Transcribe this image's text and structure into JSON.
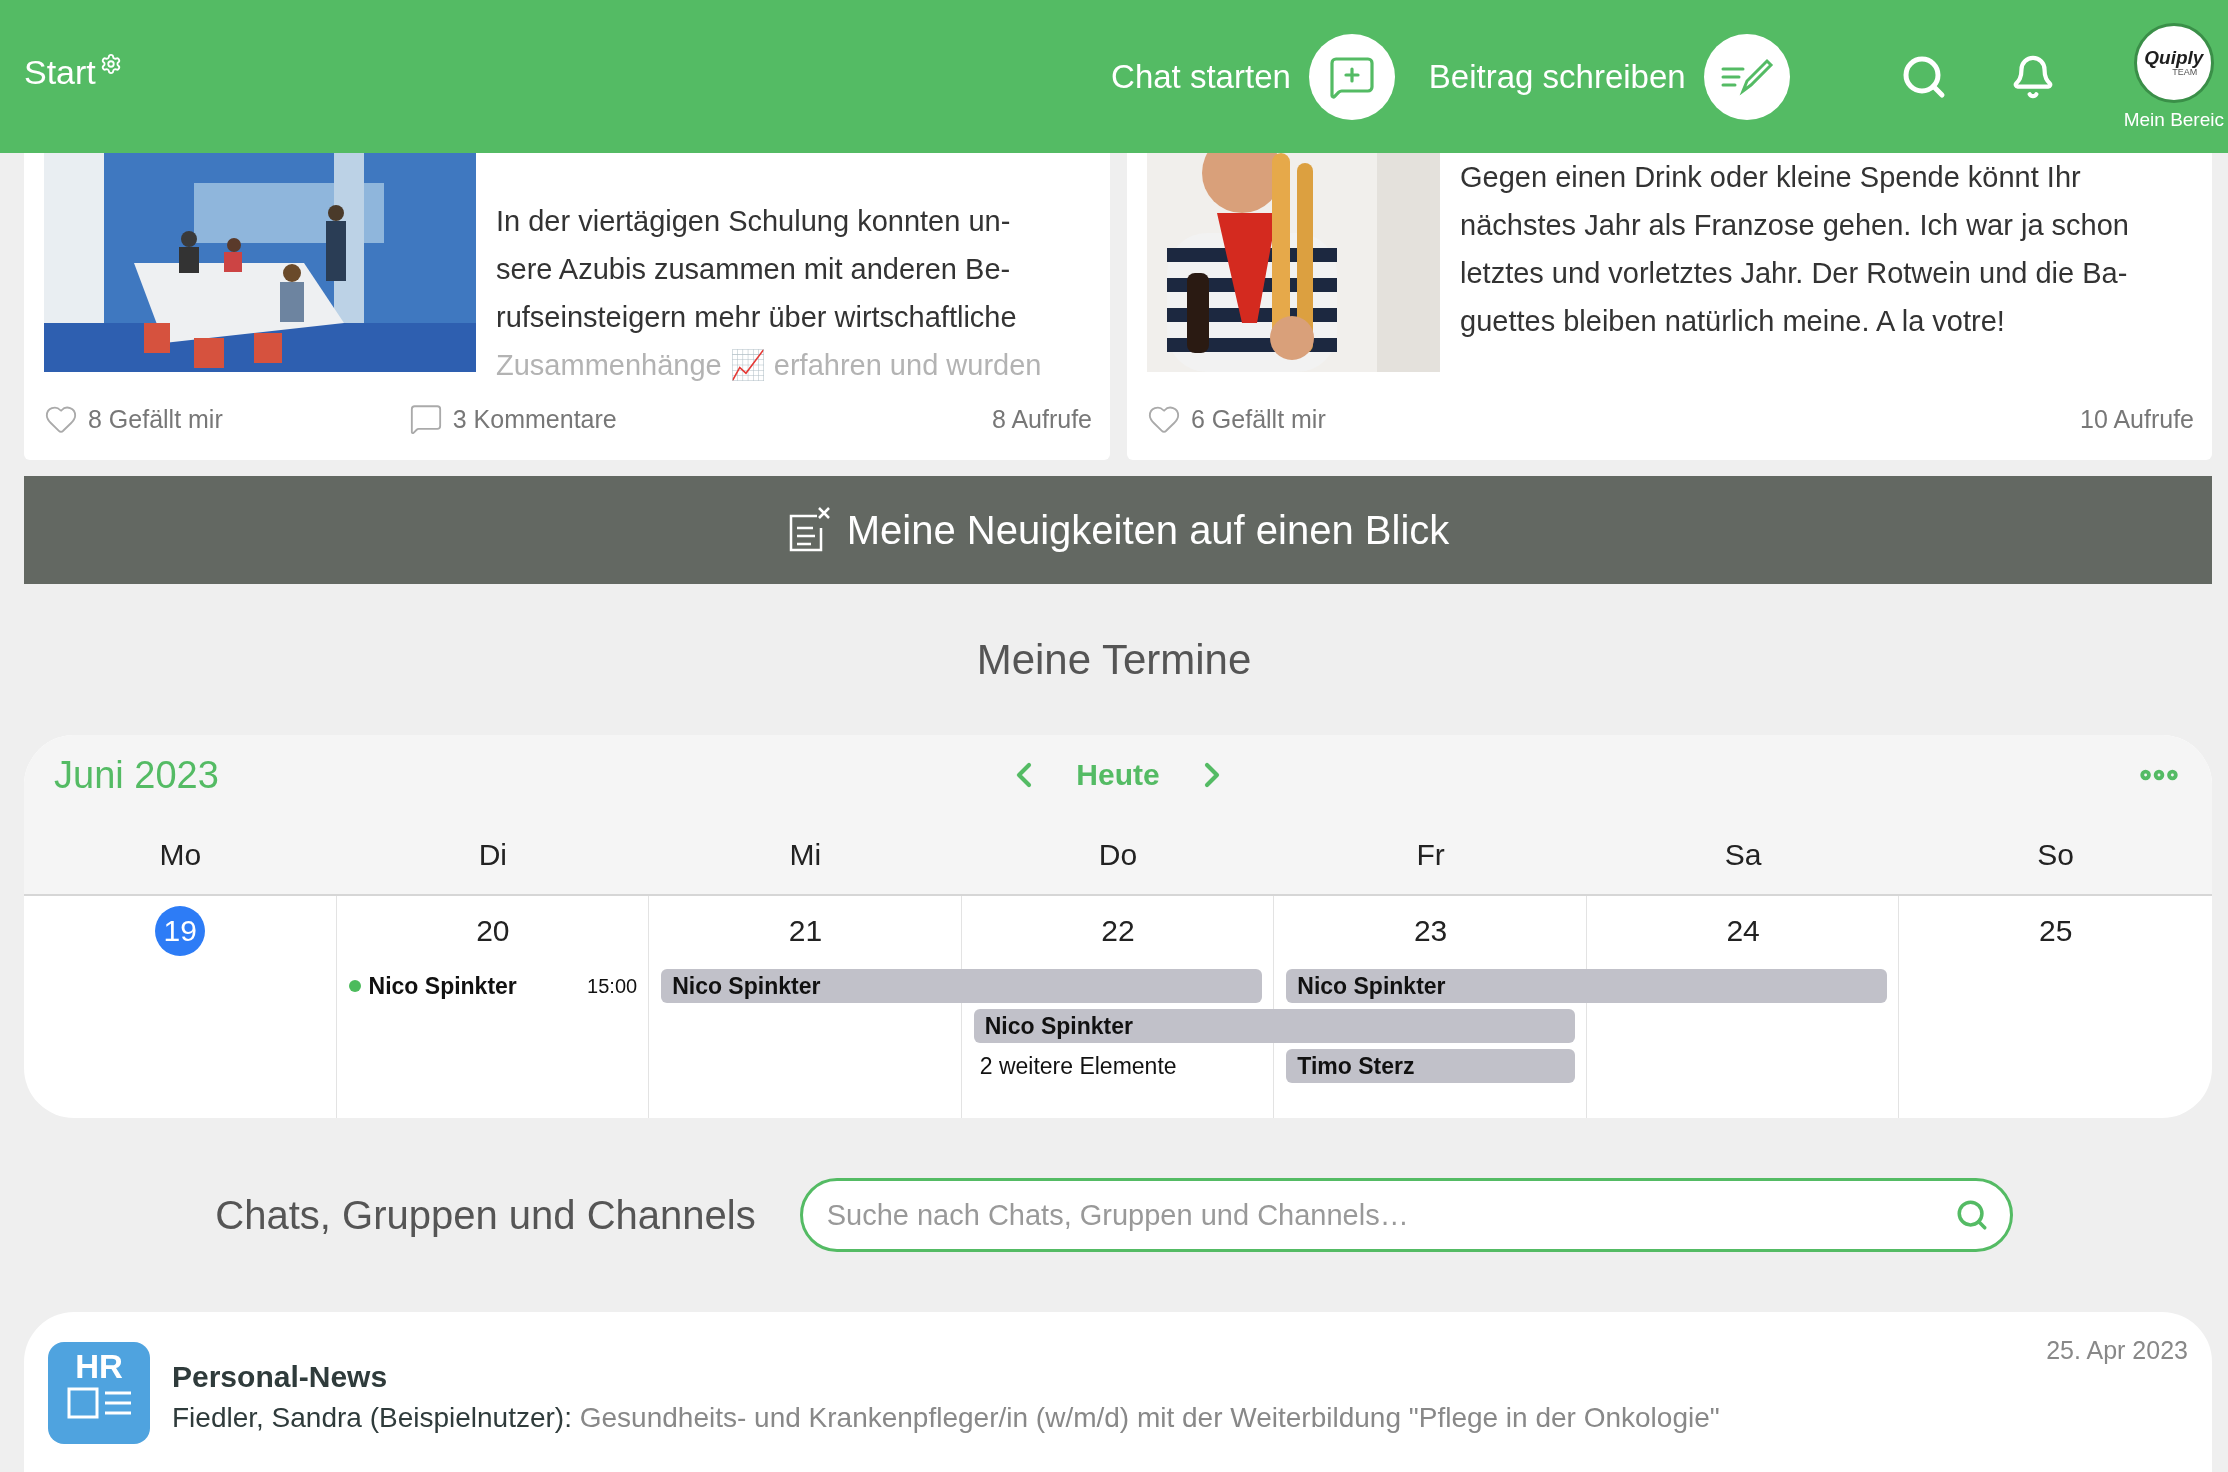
{
  "header": {
    "title": "Start",
    "actions": [
      {
        "kind": "chat",
        "label": "Chat starten"
      },
      {
        "kind": "write",
        "label": "Beitrag schreiben"
      }
    ],
    "profile": {
      "logo": "Quiply",
      "logo_sub": "TEAM",
      "label": "Mein Bereic"
    }
  },
  "posts": [
    {
      "lines": [
        "In der viertägigen Schulung konnten un-",
        "sere Azubis zusammen mit anderen Be-",
        "rufseinsteigern mehr über wirtschaftliche",
        "Zusammenhänge 📈 erfahren und wurden"
      ],
      "faded": true,
      "likes": "8 Gefällt mir",
      "comments": "3 Kommentare",
      "views": "8 Aufrufe"
    },
    {
      "lines": [
        "Gegen einen Drink oder kleine Spende könnt Ihr",
        "nächstes Jahr als Franzose gehen. Ich war ja schon",
        "letztes und vorletztes Jahr. Der Rotwein und die Ba-",
        "guettes bleiben natürlich meine. A la votre!"
      ],
      "faded": false,
      "likes": "6 Gefällt mir",
      "views": "10 Aufrufe"
    }
  ],
  "banner": {
    "label": "Meine Neuigkeiten auf einen Blick"
  },
  "calendar": {
    "title": "Meine Termine",
    "month": "Juni 2023",
    "today_button": "Heute",
    "days": [
      {
        "name": "Mo",
        "date": "19",
        "today": true
      },
      {
        "name": "Di",
        "date": "20",
        "today": false,
        "events": [
          {
            "kind": "timed",
            "title": "Nico Spinkter",
            "time": "15:00",
            "color": "#4cbb5c"
          }
        ]
      },
      {
        "name": "Mi",
        "date": "21",
        "today": false,
        "events": [
          {
            "kind": "bar",
            "title": "Nico Spinkter",
            "multi_day": true
          }
        ]
      },
      {
        "name": "Do",
        "date": "22",
        "today": false,
        "events": [
          {
            "kind": "bar",
            "title": "Nico Spinkter",
            "multi_day": true
          },
          {
            "kind": "more",
            "title": "2 weitere Elemente"
          }
        ]
      },
      {
        "name": "Fr",
        "date": "23",
        "today": false,
        "events": [
          {
            "kind": "bar",
            "title": "Nico Spinkter",
            "multi_day": true
          },
          {
            "kind": "bar",
            "title": "Timo Sterz",
            "multi_day": false
          }
        ]
      },
      {
        "name": "Sa",
        "date": "24",
        "today": false
      },
      {
        "name": "So",
        "date": "25",
        "today": false
      }
    ]
  },
  "chats": {
    "title": "Chats, Gruppen und Channels",
    "search": {
      "placeholder": "Suche nach Chats, Gruppen und Channels…"
    },
    "items": [
      {
        "badge": "HR",
        "name": "Personal-News",
        "sender": "Fiedler, Sandra (Beispielnutzer):",
        "message": "Gesundheits- und Krankenpfleger/in (w/m/d) mit der Weiterbildung \"Pflege in der Onkologie\"",
        "date": "25. Apr 2023"
      }
    ]
  }
}
